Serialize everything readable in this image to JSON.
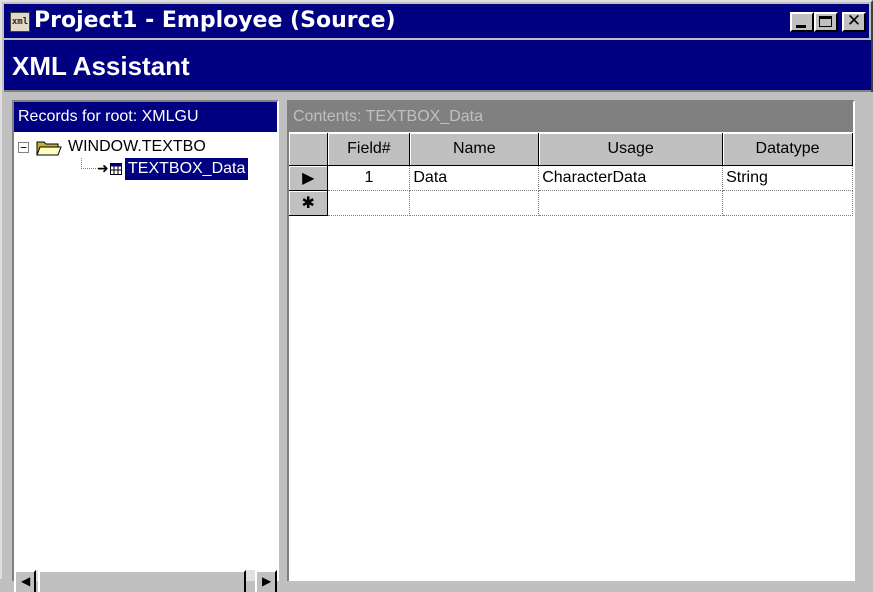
{
  "window": {
    "title": "Project1 - Employee (Source)",
    "app_icon_text": "xml",
    "controls": {
      "minimize": "minimize",
      "maximize": "maximize",
      "close": "✕"
    }
  },
  "header": {
    "title": "XML Assistant"
  },
  "left_pane": {
    "header": "Records for root: XMLGU",
    "tree": {
      "root": {
        "label": "WINDOW.TEXTBO",
        "expander": "−"
      },
      "child": {
        "label": "TEXTBOX_Data"
      }
    }
  },
  "right_pane": {
    "header": "Contents: TEXTBOX_Data",
    "columns": [
      "Field#",
      "Name",
      "Usage",
      "Datatype"
    ],
    "rows": [
      {
        "selector": "▶",
        "field": "1",
        "name": "Data",
        "usage": "CharacterData",
        "datatype": "String"
      },
      {
        "selector": "✱",
        "field": "",
        "name": "",
        "usage": "",
        "datatype": ""
      }
    ]
  },
  "colors": {
    "title_bar": "#000080",
    "face": "#c0c0c0",
    "header_band": "#000080",
    "selection": "#000080",
    "contents_header": "#808080"
  }
}
